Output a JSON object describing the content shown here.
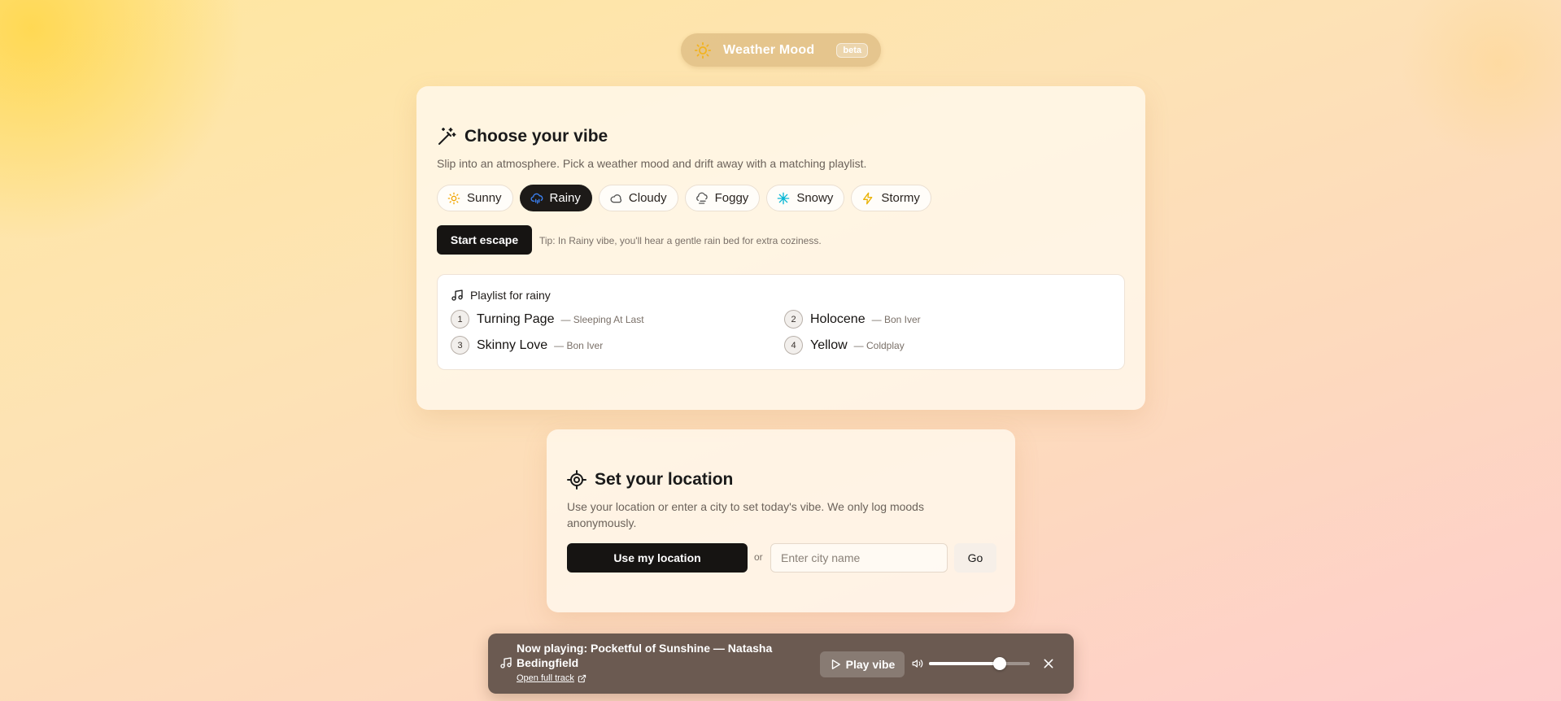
{
  "header": {
    "app_name": "Weather Mood",
    "badge": "beta",
    "icon": "sun-icon"
  },
  "vibe": {
    "title": "Choose your vibe",
    "subtitle": "Slip into an atmosphere. Pick a weather mood and drift away with a matching playlist.",
    "moods": [
      {
        "label": "Sunny",
        "icon": "sun-icon",
        "color": "#f0a500",
        "active": false
      },
      {
        "label": "Rainy",
        "icon": "cloud-rain-icon",
        "color": "#3b82f6",
        "active": true
      },
      {
        "label": "Cloudy",
        "icon": "cloud-icon",
        "color": "#555555",
        "active": false
      },
      {
        "label": "Foggy",
        "icon": "fog-icon",
        "color": "#555555",
        "active": false
      },
      {
        "label": "Snowy",
        "icon": "snowflake-icon",
        "color": "#06b6d4",
        "active": false
      },
      {
        "label": "Stormy",
        "icon": "lightning-icon",
        "color": "#eab308",
        "active": false
      }
    ],
    "start_label": "Start escape",
    "tip": "Tip: In Rainy vibe, you'll hear a gentle rain bed for extra coziness.",
    "playlist": {
      "title": "Playlist for rainy",
      "tracks": [
        {
          "num": "1",
          "name": "Turning Page",
          "artist": "— Sleeping At Last"
        },
        {
          "num": "2",
          "name": "Holocene",
          "artist": "— Bon Iver"
        },
        {
          "num": "3",
          "name": "Skinny Love",
          "artist": "— Bon Iver"
        },
        {
          "num": "4",
          "name": "Yellow",
          "artist": "— Coldplay"
        }
      ]
    }
  },
  "location": {
    "title": "Set your location",
    "subtitle": "Use your location or enter a city to set today's vibe. We only log moods anonymously.",
    "use_location_label": "Use my location",
    "or_label": "or",
    "city_placeholder": "Enter city name",
    "city_value": "",
    "go_label": "Go"
  },
  "player": {
    "now_playing": "Now playing: Pocketful of Sunshine — Natasha Bedingfield",
    "open_label": "Open full track",
    "play_label": "Play vibe",
    "volume": 0.7
  }
}
